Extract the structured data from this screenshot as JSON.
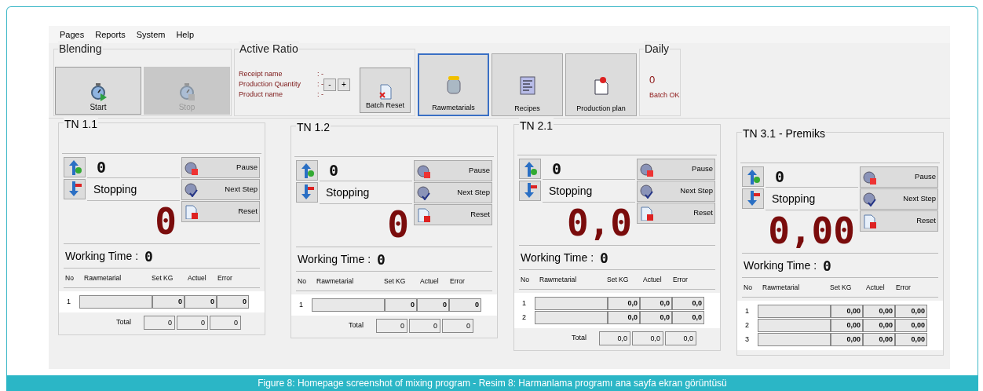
{
  "menu": [
    "Pages",
    "Reports",
    "System",
    "Help"
  ],
  "blending": {
    "title": "Blending",
    "buttons": [
      {
        "label": "Start",
        "disabled": false
      },
      {
        "label": "Stop",
        "disabled": true
      }
    ]
  },
  "active_ratio": {
    "title": "Active Ratio",
    "fields": [
      {
        "label": "Receipt name",
        "value": ": -"
      },
      {
        "label": "Production Quantity",
        "value": ": -"
      },
      {
        "label": "Product name",
        "value": ": -"
      }
    ],
    "steppers": [
      "-",
      "+"
    ],
    "batch_reset": "Batch Reset"
  },
  "nav_buttons": [
    {
      "label": "Rawmetarials",
      "kind": "jar",
      "selected": true
    },
    {
      "label": "Recipes",
      "kind": "list",
      "selected": false
    },
    {
      "label": "Production plan",
      "kind": "pin",
      "selected": false
    }
  ],
  "daily": {
    "title": "Daily",
    "count": "0",
    "label": "Batch OK"
  },
  "tanks": [
    {
      "title": "TN 1.1",
      "counter": "0",
      "status": "Stopping",
      "weight": "0",
      "actions": [
        "Pause",
        "Next Step",
        "Reset"
      ],
      "working_time_label": "Working Time :",
      "working_time": "0",
      "columns": [
        "No",
        "Rawmetarial",
        "Set KG",
        "Actuel",
        "Error"
      ],
      "rows": [
        {
          "no": "1",
          "set": "0",
          "actual": "0",
          "error": "0"
        }
      ],
      "total_label": "Total",
      "totals": [
        "0",
        "0",
        "0"
      ]
    },
    {
      "title": "TN 1.2",
      "counter": "0",
      "status": "Stopping",
      "weight": "0",
      "actions": [
        "Pause",
        "Next Step",
        "Reset"
      ],
      "working_time_label": "Working Time :",
      "working_time": "0",
      "columns": [
        "No",
        "Rawmetarial",
        "Set KG",
        "Actuel",
        "Error"
      ],
      "rows": [
        {
          "no": "1",
          "set": "0",
          "actual": "0",
          "error": "0"
        }
      ],
      "total_label": "Total",
      "totals": [
        "0",
        "0",
        "0"
      ]
    },
    {
      "title": "TN 2.1",
      "counter": "0",
      "status": "Stopping",
      "weight": "0,0",
      "actions": [
        "Pause",
        "Next Step",
        "Reset"
      ],
      "working_time_label": "Working Time :",
      "working_time": "0",
      "columns": [
        "No",
        "Rawmetarial",
        "Set KG",
        "Actuel",
        "Error"
      ],
      "rows": [
        {
          "no": "1",
          "set": "0,0",
          "actual": "0,0",
          "error": "0,0"
        },
        {
          "no": "2",
          "set": "0,0",
          "actual": "0,0",
          "error": "0,0"
        }
      ],
      "total_label": "Total",
      "totals": [
        "0,0",
        "0,0",
        "0,0"
      ]
    },
    {
      "title": "TN 3.1 - Premiks",
      "counter": "0",
      "status": "Stopping",
      "weight": "0,00",
      "actions": [
        "Pause",
        "Next Step",
        "Reset"
      ],
      "working_time_label": "Working Time :",
      "working_time": "0",
      "columns": [
        "No",
        "Rawmetarial",
        "Set KG",
        "Actuel",
        "Error"
      ],
      "rows": [
        {
          "no": "1",
          "set": "0,00",
          "actual": "0,00",
          "error": "0,00"
        },
        {
          "no": "2",
          "set": "0,00",
          "actual": "0,00",
          "error": "0,00"
        },
        {
          "no": "3",
          "set": "0,00",
          "actual": "0,00",
          "error": "0,00"
        }
      ]
    }
  ],
  "caption": "Figure 8: Homepage screenshot of mixing program - Resim 8: Harmanlama programı ana sayfa ekran görüntüsü"
}
